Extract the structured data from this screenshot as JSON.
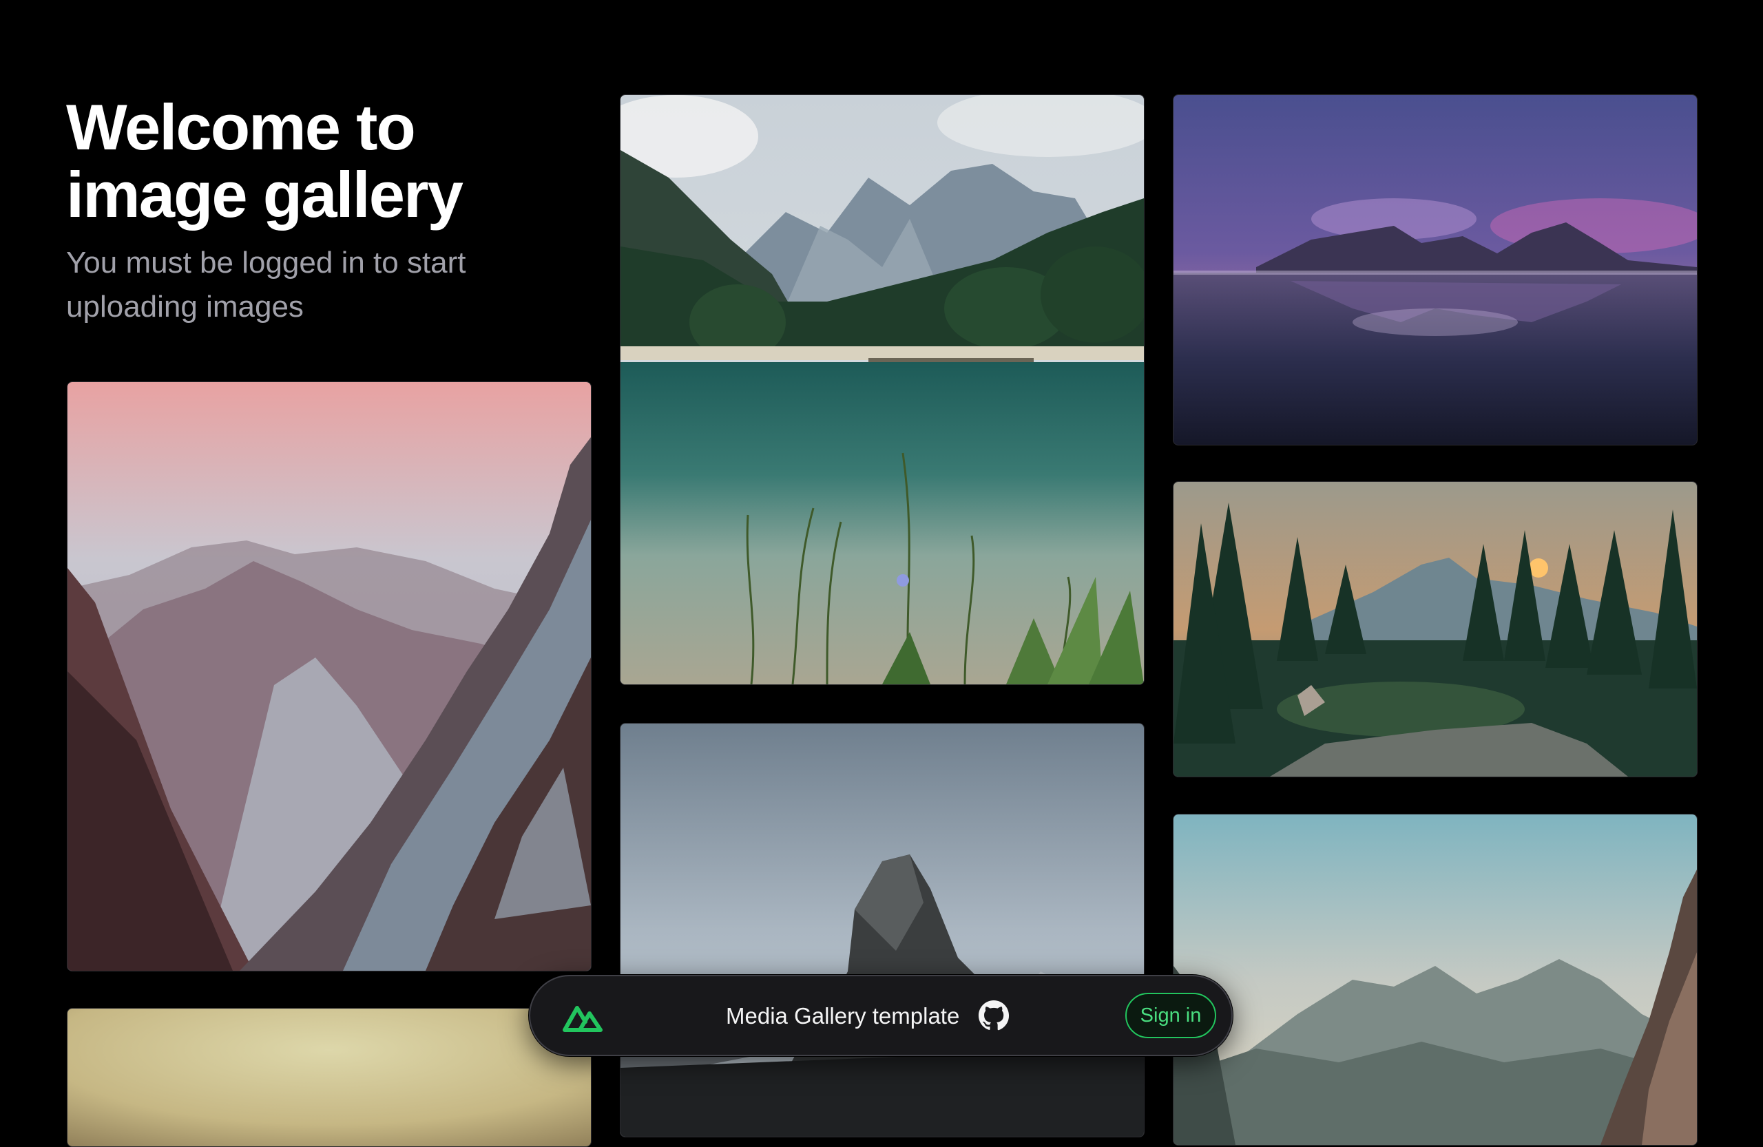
{
  "intro": {
    "title_line1": "Welcome to",
    "title_line2": "image gallery",
    "subtitle": "You must be logged in to start uploading images"
  },
  "bar": {
    "title": "Media Gallery template",
    "signin_label": "Sign in",
    "accent": "#22c55e",
    "logo_icon": "nuxt-logo-icon",
    "github_icon": "github-icon"
  },
  "gallery": {
    "images": [
      {
        "name": "lake-mountains"
      },
      {
        "name": "sunset-reflection-beach"
      },
      {
        "name": "pink-sky-rocky-mountains"
      },
      {
        "name": "forest-sunset-peak"
      },
      {
        "name": "grey-sky-rock-peak"
      },
      {
        "name": "teal-sky-misty-ridges"
      },
      {
        "name": "golden-haze"
      }
    ]
  }
}
